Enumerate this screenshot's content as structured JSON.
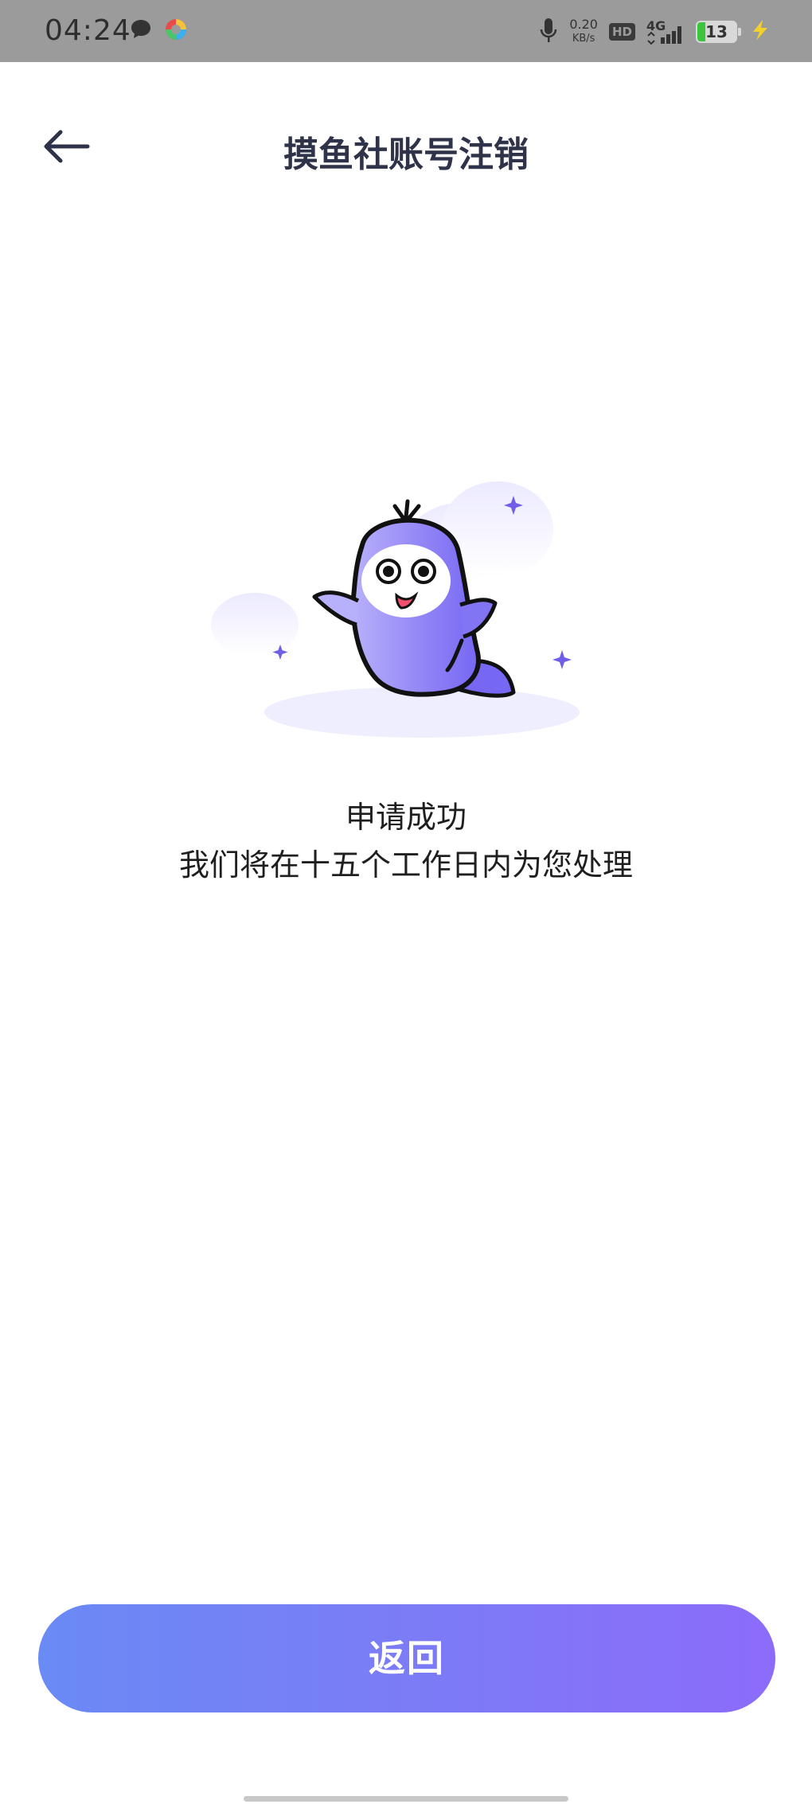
{
  "status_bar": {
    "time": "04:24",
    "net_speed_value": "0.20",
    "net_speed_unit": "KB/s",
    "hd_label": "HD",
    "network_label": "4G",
    "battery_level": "13"
  },
  "header": {
    "title": "摸鱼社账号注销"
  },
  "result": {
    "line1": "申请成功",
    "line2": "我们将在十五个工作日内为您处理"
  },
  "button": {
    "label": "返回"
  },
  "colors": {
    "button_gradient_start": "#6a8af4",
    "button_gradient_end": "#8c6bfb",
    "mascot_purple": "#8b7cf7",
    "title_color": "#2f3349"
  },
  "icons": {
    "back": "arrow-left-icon",
    "mascot": "mascot-illustration"
  }
}
